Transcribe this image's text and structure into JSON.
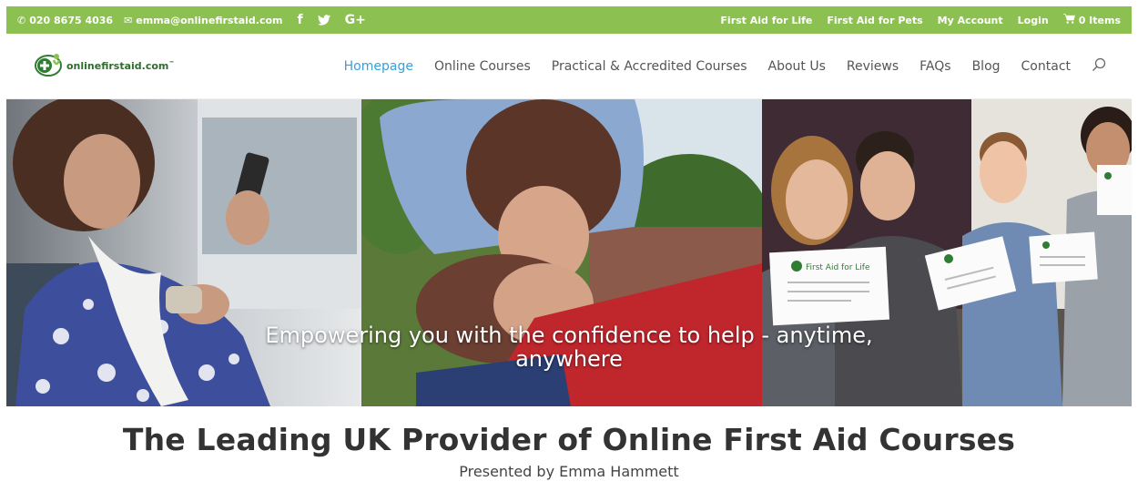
{
  "topbar": {
    "phone": "020 8675 4036",
    "email": "emma@onlinefirstaid.com",
    "social": [
      "f",
      "G+"
    ],
    "links": [
      "First Aid for Life",
      "First Aid for Pets",
      "My Account",
      "Login"
    ],
    "cart": "0 Items",
    "bg_color": "#8cc152"
  },
  "header": {
    "logo_text": "onlinefirstaid.com",
    "logo_tm": "™",
    "nav": [
      "Homepage",
      "Online Courses",
      "Practical & Accredited Courses",
      "About Us",
      "Reviews",
      "FAQs",
      "Blog",
      "Contact"
    ],
    "active_color": "#3a9fd6"
  },
  "hero": {
    "caption": "Empowering you with the confidence to help - anytime, anywhere",
    "certificate_text": "First Aid for Life"
  },
  "main": {
    "title": "The Leading UK Provider of Online First Aid Courses",
    "subtitle": "Presented by Emma Hammett"
  }
}
